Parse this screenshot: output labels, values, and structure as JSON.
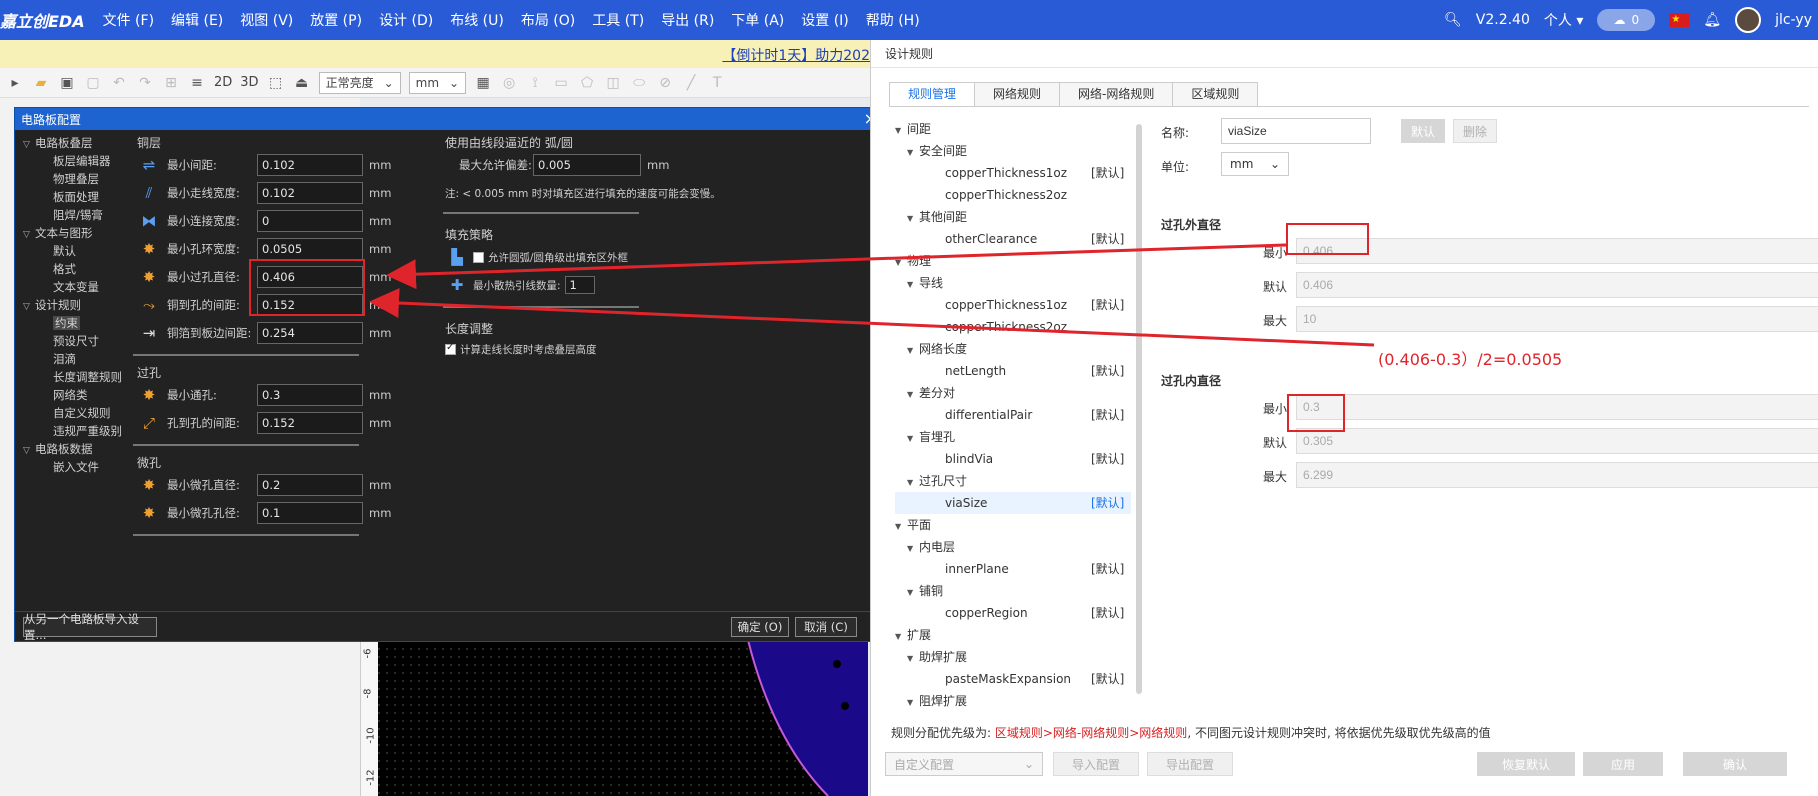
{
  "menubar": {
    "logo": "嘉立创EDA",
    "items": [
      "文件 (F)",
      "编辑 (E)",
      "视图 (V)",
      "放置 (P)",
      "设计 (D)",
      "布线 (U)",
      "布局 (O)",
      "工具 (T)",
      "导出 (R)",
      "下单 (A)",
      "设置 (I)",
      "帮助 (H)"
    ],
    "version": "V2.2.40",
    "mode": "个人",
    "cloud_count": "0",
    "flag": "★",
    "user": "jlc-yy"
  },
  "announcement": "【倒计时1天】助力202",
  "toolbar": {
    "view_2d": "2D",
    "view_3d": "3D",
    "brightness": "正常亮度",
    "unit": "mm"
  },
  "ruler_marks": [
    "-6",
    "-8",
    "-10",
    "-12"
  ],
  "board_dialog": {
    "title": "电路板配置",
    "tree": [
      {
        "label": "电路板叠层",
        "level": 0,
        "caret": "▽"
      },
      {
        "label": "板层编辑器",
        "level": 1
      },
      {
        "label": "物理叠层",
        "level": 1
      },
      {
        "label": "板面处理",
        "level": 1
      },
      {
        "label": "阻焊/锡膏",
        "level": 1
      },
      {
        "label": "文本与图形",
        "level": 0,
        "caret": "▽"
      },
      {
        "label": "默认",
        "level": 1
      },
      {
        "label": "格式",
        "level": 1
      },
      {
        "label": "文本变量",
        "level": 1
      },
      {
        "label": "设计规则",
        "level": 0,
        "caret": "▽"
      },
      {
        "label": "约束",
        "level": 1,
        "selected": true
      },
      {
        "label": "预设尺寸",
        "level": 1
      },
      {
        "label": "泪滴",
        "level": 1
      },
      {
        "label": "长度调整规则",
        "level": 1
      },
      {
        "label": "网络类",
        "level": 1
      },
      {
        "label": "自定义规则",
        "level": 1
      },
      {
        "label": "违规严重级别",
        "level": 1
      },
      {
        "label": "电路板数据",
        "level": 0,
        "caret": "▽"
      },
      {
        "label": "嵌入文件",
        "level": 1
      }
    ],
    "copper_section": "铜层",
    "copper_fields": [
      {
        "label": "最小间距:",
        "value": "0.102",
        "unit": "mm",
        "icon": "clearance-icon"
      },
      {
        "label": "最小走线宽度:",
        "value": "0.102",
        "unit": "mm",
        "icon": "track-width-icon"
      },
      {
        "label": "最小连接宽度:",
        "value": "0",
        "unit": "mm",
        "icon": "connection-width-icon"
      },
      {
        "label": "最小孔环宽度:",
        "value": "0.0505",
        "unit": "mm",
        "icon": "annular-ring-icon"
      },
      {
        "label": "最小过孔直径:",
        "value": "0.406",
        "unit": "mm",
        "icon": "via-diameter-icon"
      },
      {
        "label": "铜到孔的间距:",
        "value": "0.152",
        "unit": "mm",
        "icon": "copper-hole-icon"
      },
      {
        "label": "铜箔到板边间距:",
        "value": "0.254",
        "unit": "mm",
        "icon": "copper-edge-icon"
      }
    ],
    "hole_section": "过孔",
    "hole_fields": [
      {
        "label": "最小通孔:",
        "value": "0.3",
        "unit": "mm",
        "icon": "through-hole-icon"
      },
      {
        "label": "孔到孔的间距:",
        "value": "0.152",
        "unit": "mm",
        "icon": "hole-spacing-icon"
      }
    ],
    "micro_section": "微孔",
    "micro_fields": [
      {
        "label": "最小微孔直径:",
        "value": "0.2",
        "unit": "mm",
        "icon": "micro-via-icon"
      },
      {
        "label": "最小微孔孔径:",
        "value": "0.1",
        "unit": "mm",
        "icon": "micro-drill-icon"
      }
    ],
    "arc_section": "使用由线段逼近的 弧/圆",
    "arc_field": {
      "label": "最大允许偏差:",
      "value": "0.005",
      "unit": "mm"
    },
    "arc_note": "注: < 0.005 mm 时对填充区进行填充的速度可能会变慢。",
    "fill_section": "填充策略",
    "fill_check_label": "允许圆弧/圆角级出填充区外框",
    "fill_min_spokes_label": "最小散热引线数量:",
    "fill_min_spokes": "1",
    "length_section": "长度调整",
    "length_check_label": "计算走线长度时考虑叠层高度",
    "import_button": "从另一个电路板导入设置...",
    "ok_button": "确定 (O)",
    "cancel_button": "取消 (C)"
  },
  "rules_panel": {
    "title": "设计规则",
    "tabs": [
      "规则管理",
      "网络规则",
      "网络-网络规则",
      "区域规则"
    ],
    "tree": [
      {
        "label": "间距",
        "indent": 0,
        "caret": "▼",
        "tag": ""
      },
      {
        "label": "安全间距",
        "indent": 1,
        "caret": "▼",
        "tag": ""
      },
      {
        "label": "copperThickness1oz",
        "indent": 2,
        "caret": "",
        "tag": "[默认]"
      },
      {
        "label": "copperThickness2oz",
        "indent": 2,
        "caret": "",
        "tag": ""
      },
      {
        "label": "其他间距",
        "indent": 1,
        "caret": "▼",
        "tag": ""
      },
      {
        "label": "otherClearance",
        "indent": 2,
        "caret": "",
        "tag": "[默认]"
      },
      {
        "label": "物理",
        "indent": 0,
        "caret": "▼",
        "tag": ""
      },
      {
        "label": "导线",
        "indent": 1,
        "caret": "▼",
        "tag": ""
      },
      {
        "label": "copperThickness1oz",
        "indent": 2,
        "caret": "",
        "tag": "[默认]"
      },
      {
        "label": "copperThickness2oz",
        "indent": 2,
        "caret": "",
        "tag": ""
      },
      {
        "label": "网络长度",
        "indent": 1,
        "caret": "▼",
        "tag": ""
      },
      {
        "label": "netLength",
        "indent": 2,
        "caret": "",
        "tag": "[默认]"
      },
      {
        "label": "差分对",
        "indent": 1,
        "caret": "▼",
        "tag": ""
      },
      {
        "label": "differentialPair",
        "indent": 2,
        "caret": "",
        "tag": "[默认]"
      },
      {
        "label": "盲埋孔",
        "indent": 1,
        "caret": "▼",
        "tag": ""
      },
      {
        "label": "blindVia",
        "indent": 2,
        "caret": "",
        "tag": "[默认]"
      },
      {
        "label": "过孔尺寸",
        "indent": 1,
        "caret": "▼",
        "tag": ""
      },
      {
        "label": "viaSize",
        "indent": 2,
        "caret": "",
        "tag": "[默认]",
        "selected": true
      },
      {
        "label": "平面",
        "indent": 0,
        "caret": "▼",
        "tag": ""
      },
      {
        "label": "内电层",
        "indent": 1,
        "caret": "▼",
        "tag": ""
      },
      {
        "label": "innerPlane",
        "indent": 2,
        "caret": "",
        "tag": "[默认]"
      },
      {
        "label": "铺铜",
        "indent": 1,
        "caret": "▼",
        "tag": ""
      },
      {
        "label": "copperRegion",
        "indent": 2,
        "caret": "",
        "tag": "[默认]"
      },
      {
        "label": "扩展",
        "indent": 0,
        "caret": "▼",
        "tag": ""
      },
      {
        "label": "助焊扩展",
        "indent": 1,
        "caret": "▼",
        "tag": ""
      },
      {
        "label": "pasteMaskExpansion",
        "indent": 2,
        "caret": "",
        "tag": "[默认]"
      },
      {
        "label": "阻焊扩展",
        "indent": 1,
        "caret": "▼",
        "tag": ""
      }
    ],
    "name_label": "名称:",
    "name_value": "viaSize",
    "default_button": "默认",
    "delete_button": "删除",
    "unit_label": "单位:",
    "unit_value": "mm",
    "outer_section": "过孔外直径",
    "outer_min_label": "最小",
    "outer_min": "0.406",
    "outer_def_label": "默认",
    "outer_def": "0.406",
    "outer_max_label": "最大",
    "outer_max": "10",
    "inner_section": "过孔内直径",
    "inner_min_label": "最小",
    "inner_min": "0.3",
    "inner_def_label": "默认",
    "inner_def": "0.305",
    "inner_max_label": "最大",
    "inner_max": "6.299",
    "priority_prefix": "规则分配优先级为: ",
    "priority_red": "区域规则>网络-网络规则>网络规则",
    "priority_suffix": ", 不同图元设计规则冲突时, 将依据优先级取优先级高的值",
    "custom_config": "自定义配置",
    "import_config": "导入配置",
    "export_config": "导出配置",
    "restore_default": "恢复默认",
    "apply": "应用",
    "confirm": "确认"
  },
  "annotation": {
    "formula": "(0.406-0.3）/2=0.0505",
    "color": "#e0242b"
  }
}
